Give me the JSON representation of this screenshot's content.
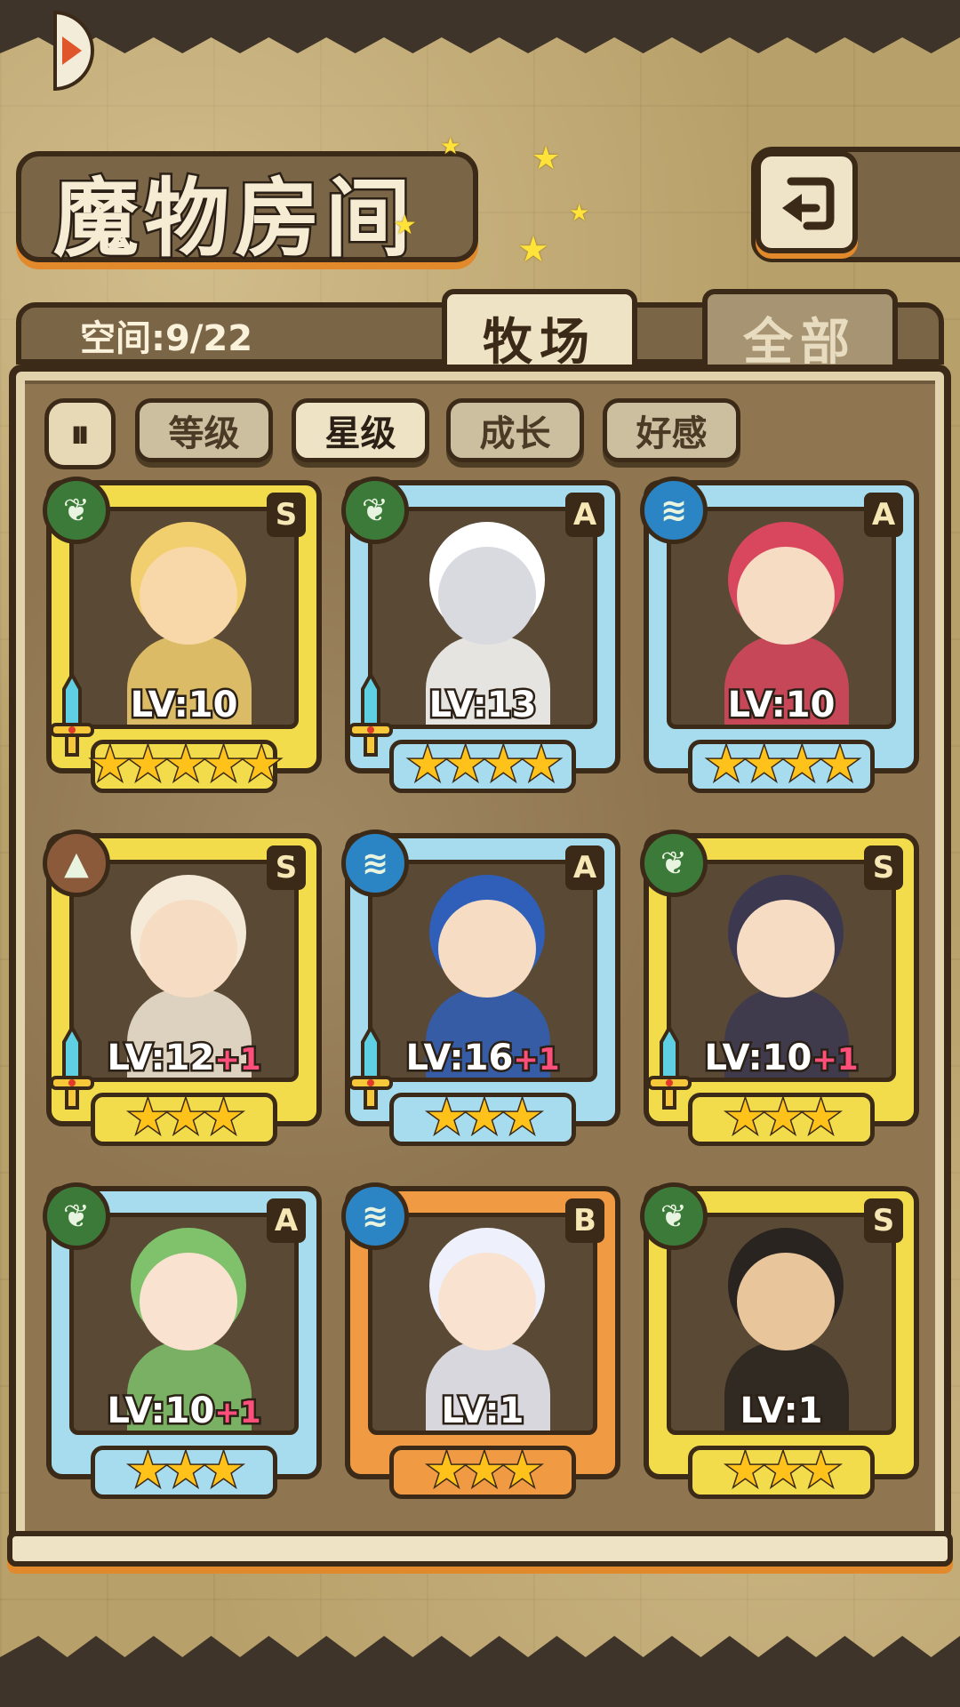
{
  "header": {
    "title": "魔物房间",
    "back_icon": "back-arrow-icon"
  },
  "panel": {
    "space_label": "空间:9/22",
    "tabs": [
      {
        "label": "牧场",
        "active": true
      },
      {
        "label": "全部",
        "active": false
      }
    ],
    "sort_toggle_icon": "sort-order-icon",
    "sort_toggle_glyph": "⏸",
    "sort_buttons": [
      {
        "label": "等级",
        "active": false
      },
      {
        "label": "星级",
        "active": true
      },
      {
        "label": "成长",
        "active": false
      },
      {
        "label": "好感",
        "active": false
      }
    ]
  },
  "colors": {
    "gold_frame": "#f3dc4c",
    "blue_frame": "#a7dcef",
    "orange_frame": "#f19a44",
    "nature": "#3c7a3a",
    "water": "#2b84c4",
    "earth": "#8a5a3a",
    "star": "#ffc21a",
    "bonus": "#ff4f7a"
  },
  "monsters": [
    {
      "rank": "S",
      "element": "nature",
      "level": "LV:10",
      "bonus": "",
      "stars": 5,
      "star_text": "★★★★★",
      "frame": "gold",
      "weapon": true,
      "skin": "#f8d7a8",
      "hair": "#f2cf6e"
    },
    {
      "rank": "A",
      "element": "nature",
      "level": "LV:13",
      "bonus": "",
      "stars": 4,
      "star_text": "★★★★",
      "frame": "blue",
      "weapon": true,
      "skin": "#d9d9e0",
      "hair": "#ffffff"
    },
    {
      "rank": "A",
      "element": "water",
      "level": "LV:10",
      "bonus": "",
      "stars": 4,
      "star_text": "★★★★",
      "frame": "blue",
      "weapon": false,
      "skin": "#f7dcc4",
      "hair": "#d9475e"
    },
    {
      "rank": "S",
      "element": "earth",
      "level": "LV:12",
      "bonus": "+1",
      "stars": 3,
      "star_text": "★★★",
      "frame": "gold",
      "weapon": true,
      "skin": "#f7dcc4",
      "hair": "#f4ead7"
    },
    {
      "rank": "A",
      "element": "water",
      "level": "LV:16",
      "bonus": "+1",
      "stars": 3,
      "star_text": "★★★",
      "frame": "blue",
      "weapon": true,
      "skin": "#f7dcc4",
      "hair": "#2f5fb8"
    },
    {
      "rank": "S",
      "element": "nature",
      "level": "LV:10",
      "bonus": "+1",
      "stars": 3,
      "star_text": "★★★",
      "frame": "gold",
      "weapon": true,
      "skin": "#f7dcc4",
      "hair": "#3c3850"
    },
    {
      "rank": "A",
      "element": "nature",
      "level": "LV:10",
      "bonus": "+1",
      "stars": 3,
      "star_text": "★★★",
      "frame": "blue",
      "weapon": false,
      "skin": "#f9e2cf",
      "hair": "#7fc26b"
    },
    {
      "rank": "B",
      "element": "water",
      "level": "LV:1",
      "bonus": "",
      "stars": 3,
      "star_text": "★★★",
      "frame": "orange",
      "weapon": false,
      "skin": "#f9e2cf",
      "hair": "#eef0fb"
    },
    {
      "rank": "S",
      "element": "nature",
      "level": "LV:1",
      "bonus": "",
      "stars": 3,
      "star_text": "★★★",
      "frame": "gold",
      "weapon": false,
      "skin": "#e9c59b",
      "hair": "#2a2420"
    }
  ]
}
